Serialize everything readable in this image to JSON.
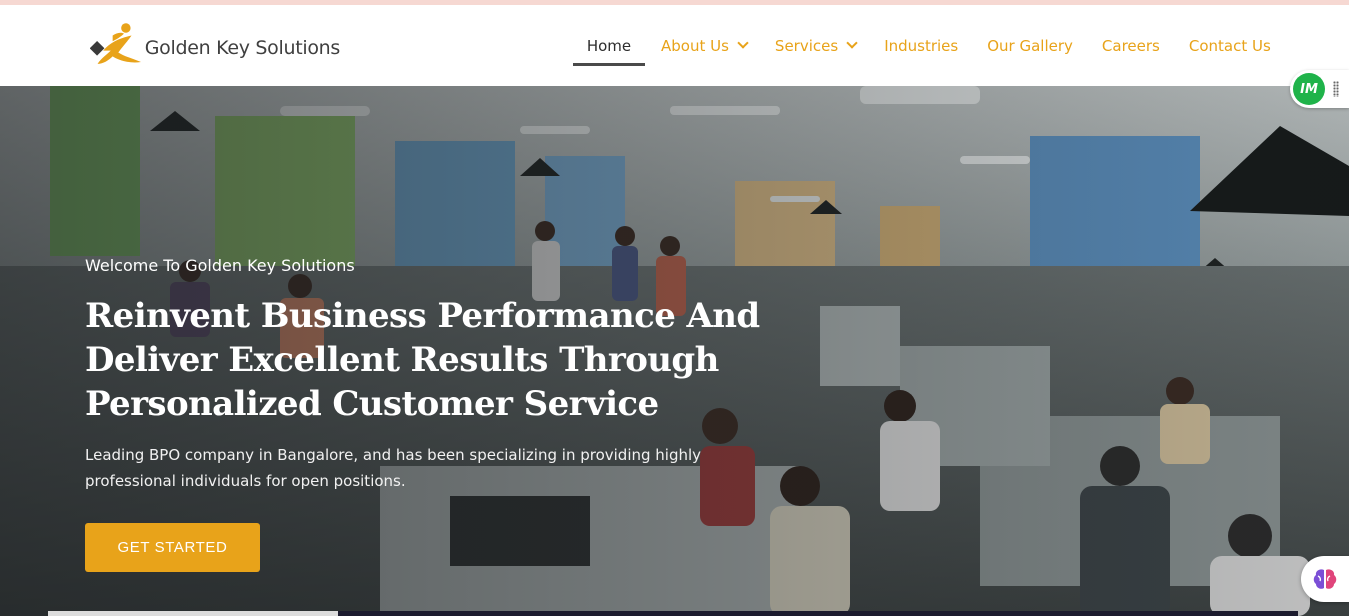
{
  "brand": {
    "name": "Golden Key Solutions",
    "logo_icon": "running-figure-key-icon"
  },
  "nav": {
    "items": [
      {
        "label": "Home",
        "active": true,
        "dropdown": false
      },
      {
        "label": "About Us",
        "active": false,
        "dropdown": true
      },
      {
        "label": "Services",
        "active": false,
        "dropdown": true
      },
      {
        "label": "Industries",
        "active": false,
        "dropdown": false
      },
      {
        "label": "Our Gallery",
        "active": false,
        "dropdown": false
      },
      {
        "label": "Careers",
        "active": false,
        "dropdown": false
      },
      {
        "label": "Contact Us",
        "active": false,
        "dropdown": false
      }
    ]
  },
  "hero": {
    "welcome": "Welcome To Golden Key Solutions",
    "headline_lines": [
      "Reinvent Business Performance And",
      "Deliver Excellent Results Through",
      "Personalized Customer Service"
    ],
    "description": "Leading BPO company in Bangalore, and has been specializing in providing highly professional individuals for open positions.",
    "cta_label": "GET STARTED",
    "background_image": "call-center-office-photo"
  },
  "widgets": {
    "im_badge_label": "IM",
    "brain_icon": "brain-icon"
  },
  "colors": {
    "accent": "#e8a31a",
    "nav_active": "#2d2d2d",
    "im_green": "#1fb34a",
    "logo_text": "#3f3f3f"
  }
}
